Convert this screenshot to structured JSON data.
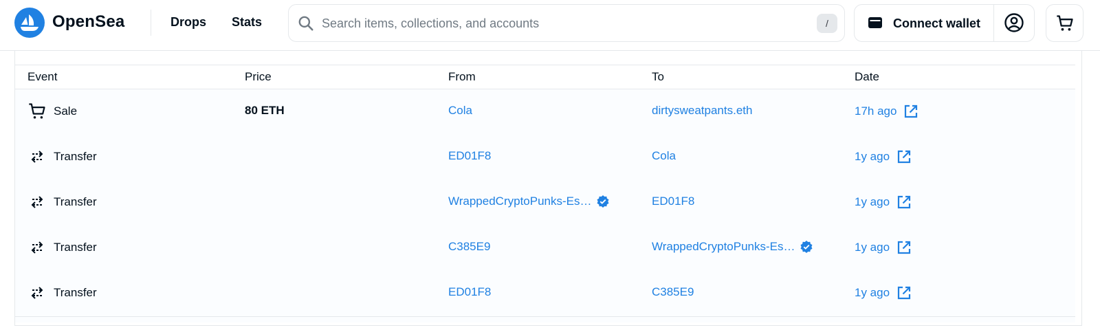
{
  "header": {
    "brand": "OpenSea",
    "nav": [
      {
        "label": "Drops"
      },
      {
        "label": "Stats"
      }
    ],
    "search": {
      "placeholder": "Search items, collections, and accounts",
      "value": "",
      "shortcut": "/"
    },
    "wallet_label": "Connect wallet",
    "icons": {
      "logo": "opensea-logo",
      "search": "search-icon",
      "wallet": "wallet-icon",
      "profile": "account-circle-icon",
      "cart": "shopping-cart-icon"
    },
    "colors": {
      "brand": "#2081e2",
      "text": "#04111d",
      "border": "#e5e8eb"
    }
  },
  "activity": {
    "columns": [
      "Event",
      "Price",
      "From",
      "To",
      "Date"
    ],
    "rows": [
      {
        "event": "Sale",
        "event_icon": "cart-icon",
        "price": "80 ETH",
        "from": "Cola",
        "from_verified": false,
        "to": "dirtysweatpants.eth",
        "to_verified": false,
        "date": "17h ago"
      },
      {
        "event": "Transfer",
        "event_icon": "transfer-arrows-icon",
        "price": "",
        "from": "ED01F8",
        "from_verified": false,
        "to": "Cola",
        "to_verified": false,
        "date": "1y ago"
      },
      {
        "event": "Transfer",
        "event_icon": "transfer-arrows-icon",
        "price": "",
        "from": "WrappedCryptoPunks-Es…",
        "from_verified": true,
        "to": "ED01F8",
        "to_verified": false,
        "date": "1y ago"
      },
      {
        "event": "Transfer",
        "event_icon": "transfer-arrows-icon",
        "price": "",
        "from": "C385E9",
        "from_verified": false,
        "to": "WrappedCryptoPunks-Es…",
        "to_verified": true,
        "date": "1y ago"
      },
      {
        "event": "Transfer",
        "event_icon": "transfer-arrows-icon",
        "price": "",
        "from": "ED01F8",
        "from_verified": false,
        "to": "C385E9",
        "to_verified": false,
        "date": "1y ago"
      }
    ]
  }
}
